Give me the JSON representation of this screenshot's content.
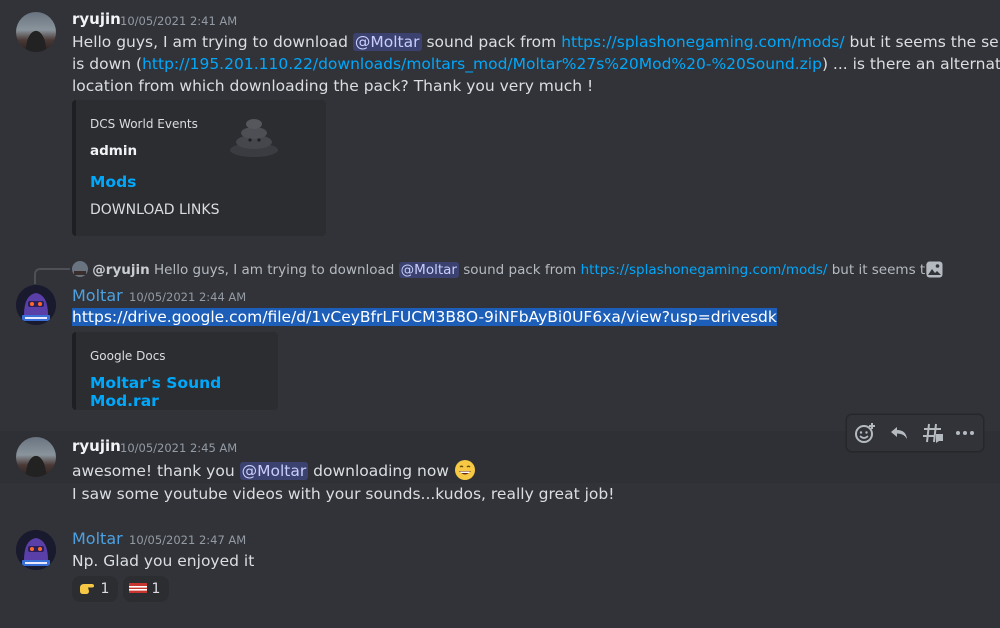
{
  "messages": [
    {
      "author": "ryujin",
      "timestamp": "10/05/2021 2:41 AM",
      "line1": {
        "pre": "Hello guys, I am trying to download ",
        "mention": "@Moltar",
        "mid": " sound pack from ",
        "link": "https://splashonegaming.com/mods/",
        "post": " but it seems the server"
      },
      "line2": {
        "pre": "is down (",
        "link": "http://195.201.110.22/downloads/moltars_mod/Moltar%27s%20Mod%20-%20Sound.zip",
        "post": ") ... is there an alternate"
      },
      "line3": "location from which downloading the pack? Thank you very much !",
      "embed": {
        "provider": "DCS World Events",
        "author": "admin",
        "title": "Mods",
        "description": "DOWNLOAD LINKS"
      }
    },
    {
      "reply": {
        "author": "@ryujin",
        "pre": " Hello guys, I am trying to download ",
        "mention": "@Moltar",
        "mid": " sound pack from ",
        "link": "https://splashonegaming.com/mods/",
        "post": " but it seems the server is c"
      },
      "author": "Moltar",
      "timestamp": "10/05/2021 2:44 AM",
      "link": "https://drive.google.com/file/d/1vCeyBfrLFUCM3B8O-9iNFbAyBi0UF6xa/view?usp=drivesdk",
      "embed": {
        "provider": "Google Docs",
        "title": "Moltar's Sound Mod.rar"
      }
    },
    {
      "author": "ryujin",
      "timestamp": "10/05/2021 2:45 AM",
      "line1": {
        "pre": "awesome! thank you ",
        "mention": "@Moltar",
        "post": " downloading now"
      },
      "line2": "I saw some youtube videos with your sounds...kudos, really great job!"
    },
    {
      "author": "Moltar",
      "timestamp": "10/05/2021 2:47 AM",
      "text": "Np. Glad you enjoyed it",
      "reactions": [
        {
          "emoji": "point-right-emoji",
          "count": "1"
        },
        {
          "emoji": "flag-emoji",
          "count": "1"
        }
      ]
    }
  ],
  "toolbar": {
    "icons": [
      "add-reaction-icon",
      "reply-icon",
      "create-thread-icon",
      "more-options-icon"
    ]
  }
}
